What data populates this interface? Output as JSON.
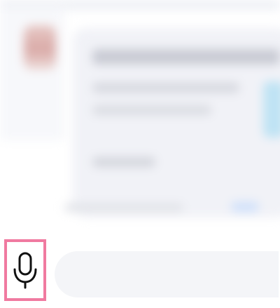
{
  "app": {
    "name": ""
  },
  "composer": {
    "mic_icon": "microphone-icon",
    "input_value": "",
    "input_placeholder": ""
  },
  "highlight": {
    "color": "#f07aa0"
  },
  "message": {
    "content_state": "blurred"
  }
}
